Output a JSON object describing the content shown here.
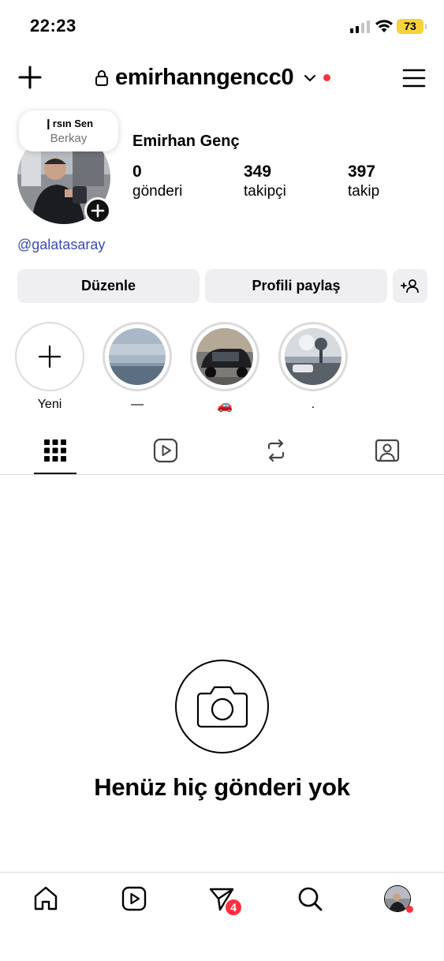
{
  "status_bar": {
    "time": "22:23",
    "battery": "73"
  },
  "header": {
    "username": "emirhanngencc0",
    "icons": [
      "plus-icon",
      "lock-icon",
      "chevron-down-icon",
      "menu-icon"
    ]
  },
  "profile": {
    "note_line1": "❙rsın  Sen",
    "note_line2": "Berkay",
    "display_name": "Emirhan Genç",
    "stats": [
      {
        "value": "0",
        "label": "gönderi"
      },
      {
        "value": "349",
        "label": "takipçi"
      },
      {
        "value": "397",
        "label": "takip"
      }
    ],
    "bio_link": "@galatasaray"
  },
  "actions": {
    "edit_label": "Düzenle",
    "share_label": "Profili paylaş"
  },
  "highlights": [
    {
      "label": "Yeni",
      "type": "new"
    },
    {
      "label": "—",
      "type": "sea"
    },
    {
      "label": "🚗",
      "type": "car"
    },
    {
      "label": ".",
      "type": "street"
    }
  ],
  "tabs": [
    "grid-icon",
    "reels-icon",
    "repost-icon",
    "tagged-icon"
  ],
  "empty_state": {
    "text": "Henüz hiç gönderi yok",
    "icon": "camera-icon"
  },
  "bottom_nav": {
    "items": [
      "home-icon",
      "reels-icon",
      "activity-icon",
      "search-icon",
      "profile-avatar"
    ],
    "activity_badge": "4"
  },
  "colors": {
    "link": "#3b4bb5",
    "badge": "#ff3040",
    "button_bg": "#efeff1",
    "battery": "#f7d23a"
  }
}
